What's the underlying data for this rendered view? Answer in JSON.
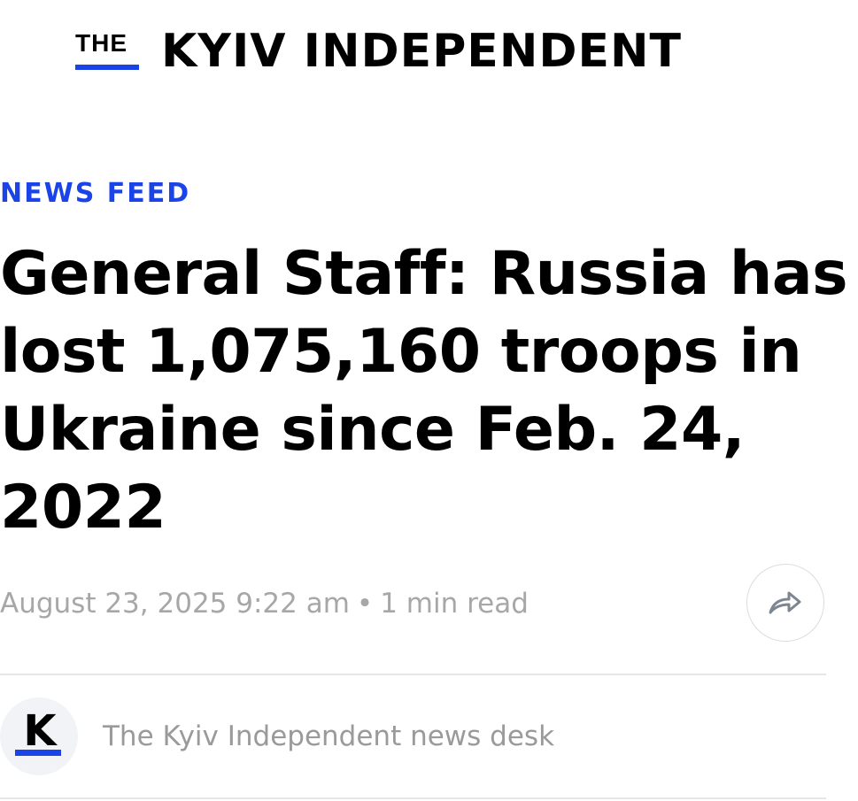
{
  "masthead": {
    "the": "THE",
    "name": "KYIV INDEPENDENT"
  },
  "article": {
    "section": "NEWS FEED",
    "headline": "General Staff: Russia has lost 1,075,160 troops in Ukraine since Feb. 24, 2022",
    "date": "August 23, 2025 9:22 am",
    "separator": "•",
    "read_time": "1 min read"
  },
  "share": {
    "icon": "share-arrow-icon"
  },
  "author": {
    "avatar_letter": "K",
    "name": "The Kyiv Independent news desk"
  },
  "colors": {
    "brand_blue": "#1a44e8",
    "meta_gray": "#a7a7a7",
    "divider": "#e6e6e6"
  }
}
